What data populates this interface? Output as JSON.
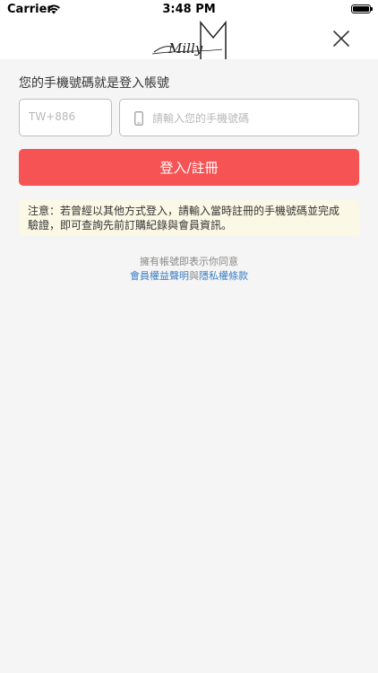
{
  "status_bar": {
    "carrier": "Carrier",
    "time": "3:48 PM"
  },
  "nav": {
    "logo_text": "Milly"
  },
  "login": {
    "prompt": "您的手機號碼就是登入帳號",
    "country_code_placeholder": "TW+886",
    "phone_placeholder": "請輸入您的手機號碼",
    "button_label": "登入/註冊"
  },
  "notice": {
    "line1": "注意：若曾經以其他方式登入，請輸入當時註冊的手機號碼並完成",
    "line2": "驗證，即可查詢先前訂購紀錄與會員資訊。"
  },
  "agreement": {
    "prefix": "擁有帳號即表示你同意",
    "terms_link": "會員權益聲明",
    "connector": "與",
    "privacy_link": "隱私權條款"
  },
  "colors": {
    "accent": "#f65355",
    "link": "#3b7fc4",
    "notice_bg": "#fcf8e6"
  }
}
